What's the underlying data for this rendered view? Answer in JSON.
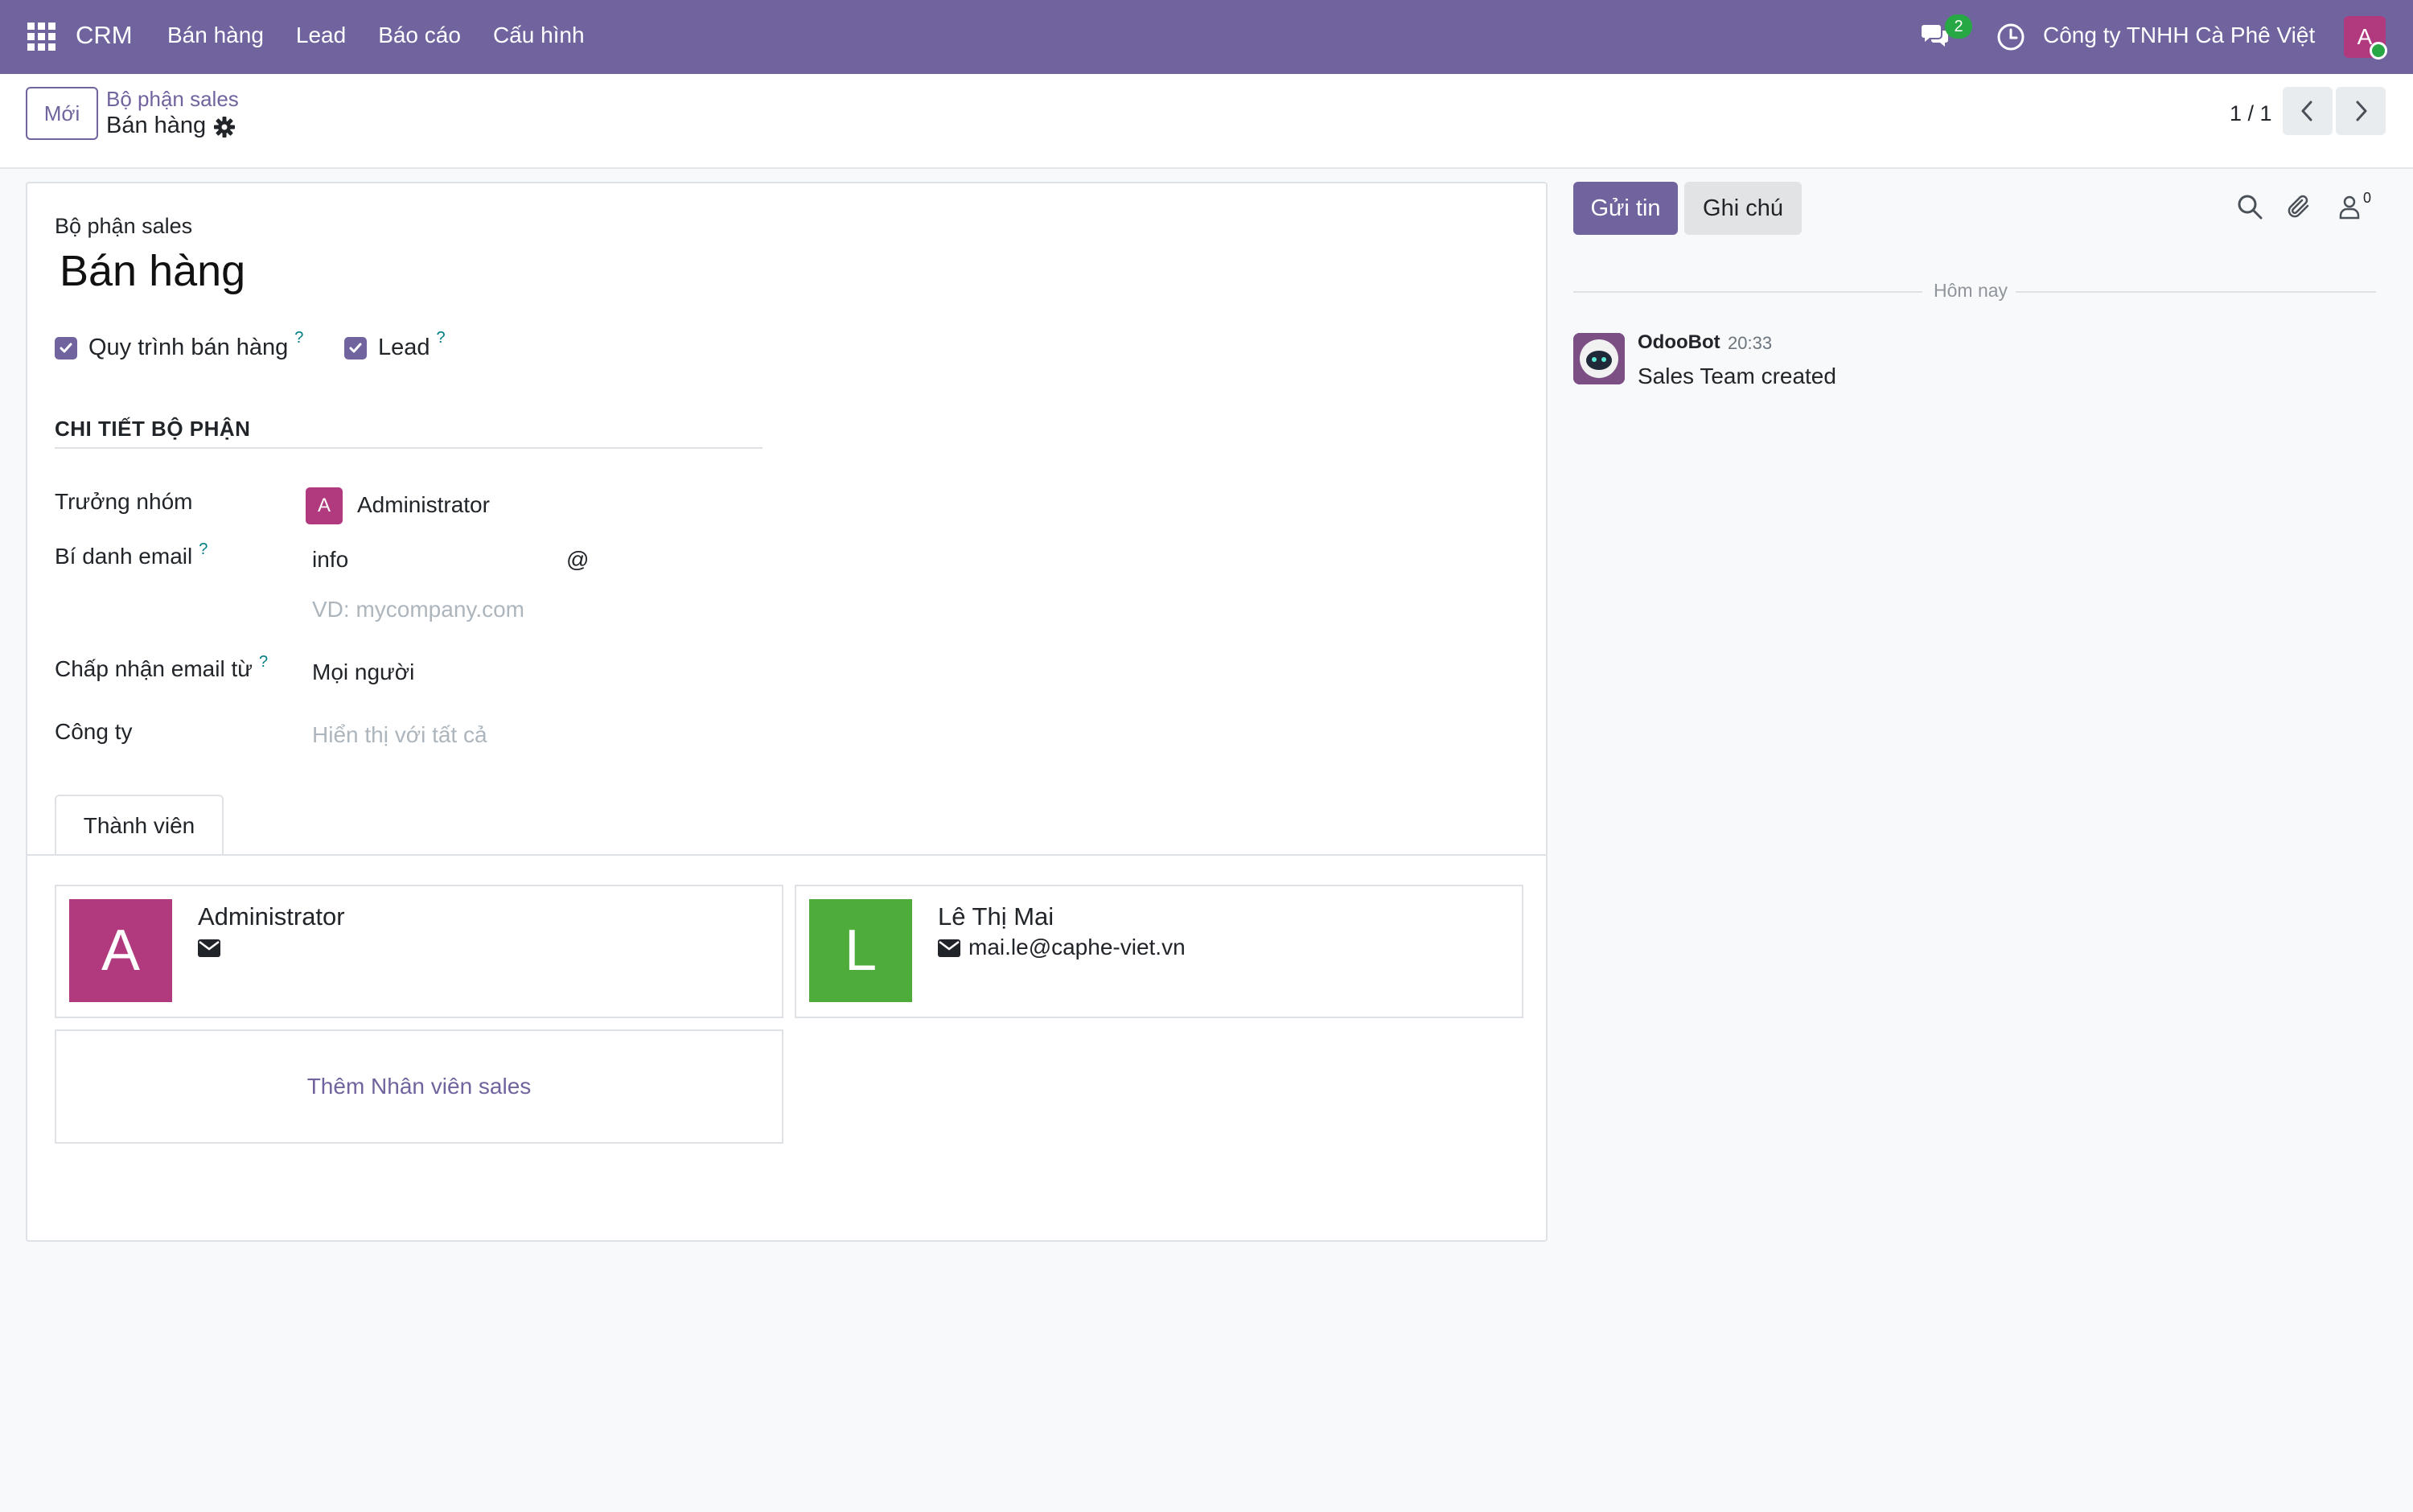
{
  "navbar": {
    "app_name": "CRM",
    "menu": [
      "Bán hàng",
      "Lead",
      "Báo cáo",
      "Cấu hình"
    ],
    "message_count": "2",
    "company": "Công ty TNHH Cà Phê Việt",
    "user_initial": "A",
    "brand_color": "#71639e"
  },
  "control_panel": {
    "new_label": "Mới",
    "breadcrumb_parent": "Bộ phận sales",
    "breadcrumb_current": "Bán hàng",
    "pager": "1 / 1"
  },
  "form": {
    "name_label": "Bộ phận sales",
    "name": "Bán hàng",
    "checkbox_pipeline": "Quy trình bán hàng",
    "checkbox_leads": "Lead",
    "help_mark": "?",
    "section_title": "CHI TIẾT BỘ PHẬN",
    "team_leader_label": "Trưởng nhóm",
    "team_leader_initial": "A",
    "team_leader": "Administrator",
    "email_alias_label": "Bí danh email",
    "email_alias": "info",
    "at_sign": "@",
    "alias_domain_placeholder": "VD: mycompany.com",
    "accept_from_label": "Chấp nhận email từ",
    "accept_from": "Mọi người",
    "company_label": "Công ty",
    "company_placeholder": "Hiển thị với tất cả"
  },
  "tabs": {
    "members": "Thành viên"
  },
  "members": [
    {
      "initial": "A",
      "name": "Administrator",
      "email": "",
      "color": "#b13a7f"
    },
    {
      "initial": "L",
      "name": "Lê Thị Mai",
      "email": "mai.le@caphe-viet.vn",
      "color": "#4dac3a"
    }
  ],
  "add_member_label": "Thêm Nhân viên sales",
  "chatter": {
    "send_label": "Gửi tin",
    "note_label": "Ghi chú",
    "follower_count": "0",
    "day_separator": "Hôm nay",
    "message": {
      "author": "OdooBot",
      "time": "20:33",
      "body": "Sales Team created"
    }
  }
}
